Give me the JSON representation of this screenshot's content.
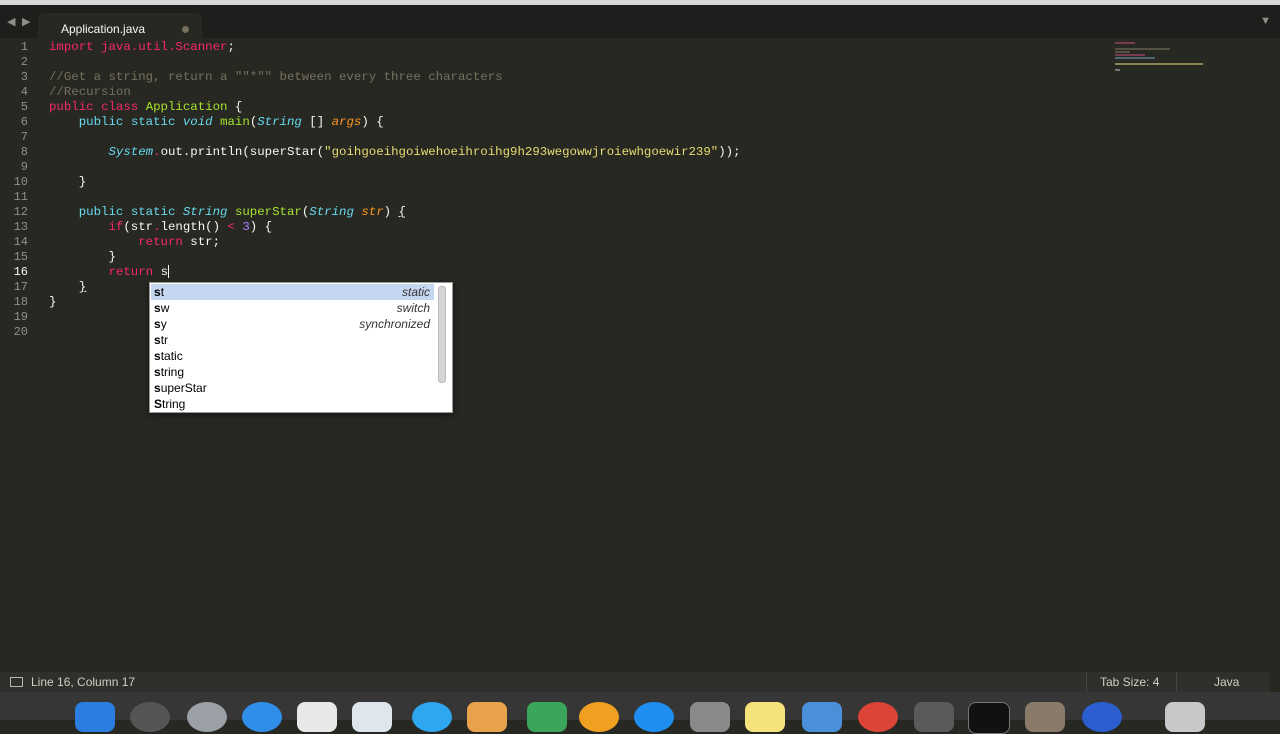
{
  "editor": {
    "tab_title": "Application.java",
    "line_numbers": [
      "1",
      "2",
      "3",
      "4",
      "5",
      "6",
      "7",
      "8",
      "9",
      "10",
      "11",
      "12",
      "13",
      "14",
      "15",
      "16",
      "17",
      "18",
      "19",
      "20"
    ],
    "current_line": "16",
    "code": {
      "l1_import": "import",
      "l1_pkg": " java.util.Scanner",
      "l1_end": ";",
      "l3_comment": "//Get a string, return a \"\"*\"\" between every three characters",
      "l4_comment": "//Recursion",
      "l5_public": "public",
      "l5_class": "class",
      "l5_name": "Application",
      "l5_brace": " {",
      "l6_public": "public",
      "l6_static": "static",
      "l6_void": "void",
      "l6_main": "main",
      "l6_open": "(",
      "l6_type": "String",
      "l6_arr": " [] ",
      "l6_args": "args",
      "l6_close": ") {",
      "l8_system": "System",
      "l8_dot1": ".",
      "l8_out": "out",
      "l8_print": ".println(superStar(",
      "l8_str": "\"goihgoeihgoiwehoeihroihg9h293wegowwjroiewhgoewir239\"",
      "l8_end": "));",
      "l10_brace": "}",
      "l12_public": "public",
      "l12_static": "static",
      "l12_type": "String",
      "l12_name": "superStar",
      "l12_open": "(",
      "l12_ptype": "String",
      "l12_param": "str",
      "l12_close": ") ",
      "l12_brace": "{",
      "l13_if": "if",
      "l13_a": "(str",
      "l13_dot": ".",
      "l13_b": "length() ",
      "l13_lt": "<",
      "l13_sp": " ",
      "l13_num": "3",
      "l13_c": ") {",
      "l14_return": "return",
      "l14_rest": " str;",
      "l15_brace": "}",
      "l16_return": "return",
      "l16_typed": "s",
      "l17_brace": "}",
      "l18_brace": "}"
    }
  },
  "autocomplete": {
    "items": [
      {
        "trigger_bold": "s",
        "trigger_rest": "t",
        "hint": "static"
      },
      {
        "trigger_bold": "s",
        "trigger_rest": "w",
        "hint": "switch"
      },
      {
        "trigger_bold": "s",
        "trigger_rest": "y",
        "hint": "synchronized"
      },
      {
        "trigger_bold": "s",
        "trigger_rest": "tr",
        "hint": ""
      },
      {
        "trigger_bold": "s",
        "trigger_rest": "tatic",
        "hint": ""
      },
      {
        "trigger_bold": "s",
        "trigger_rest": "tring",
        "hint": ""
      },
      {
        "trigger_bold": "s",
        "trigger_rest": "uperStar",
        "hint": ""
      },
      {
        "trigger_bold": "S",
        "trigger_rest": "tring",
        "hint": ""
      }
    ]
  },
  "status_bar": {
    "position": "Line 16, Column 17",
    "tab_size": "Tab Size: 4",
    "syntax": "Java"
  },
  "colors": {
    "background": "#272822",
    "keyword": "#f92672",
    "storage": "#66d9ef",
    "function": "#a6e22e",
    "comment": "#75715e",
    "string": "#e6db74",
    "number": "#ae81ff",
    "parameter": "#fd971f"
  },
  "icons": [
    "back-icon",
    "forward-icon",
    "tab-unsaved-dot-icon",
    "tab-menu-icon",
    "panel-toggle-icon"
  ]
}
